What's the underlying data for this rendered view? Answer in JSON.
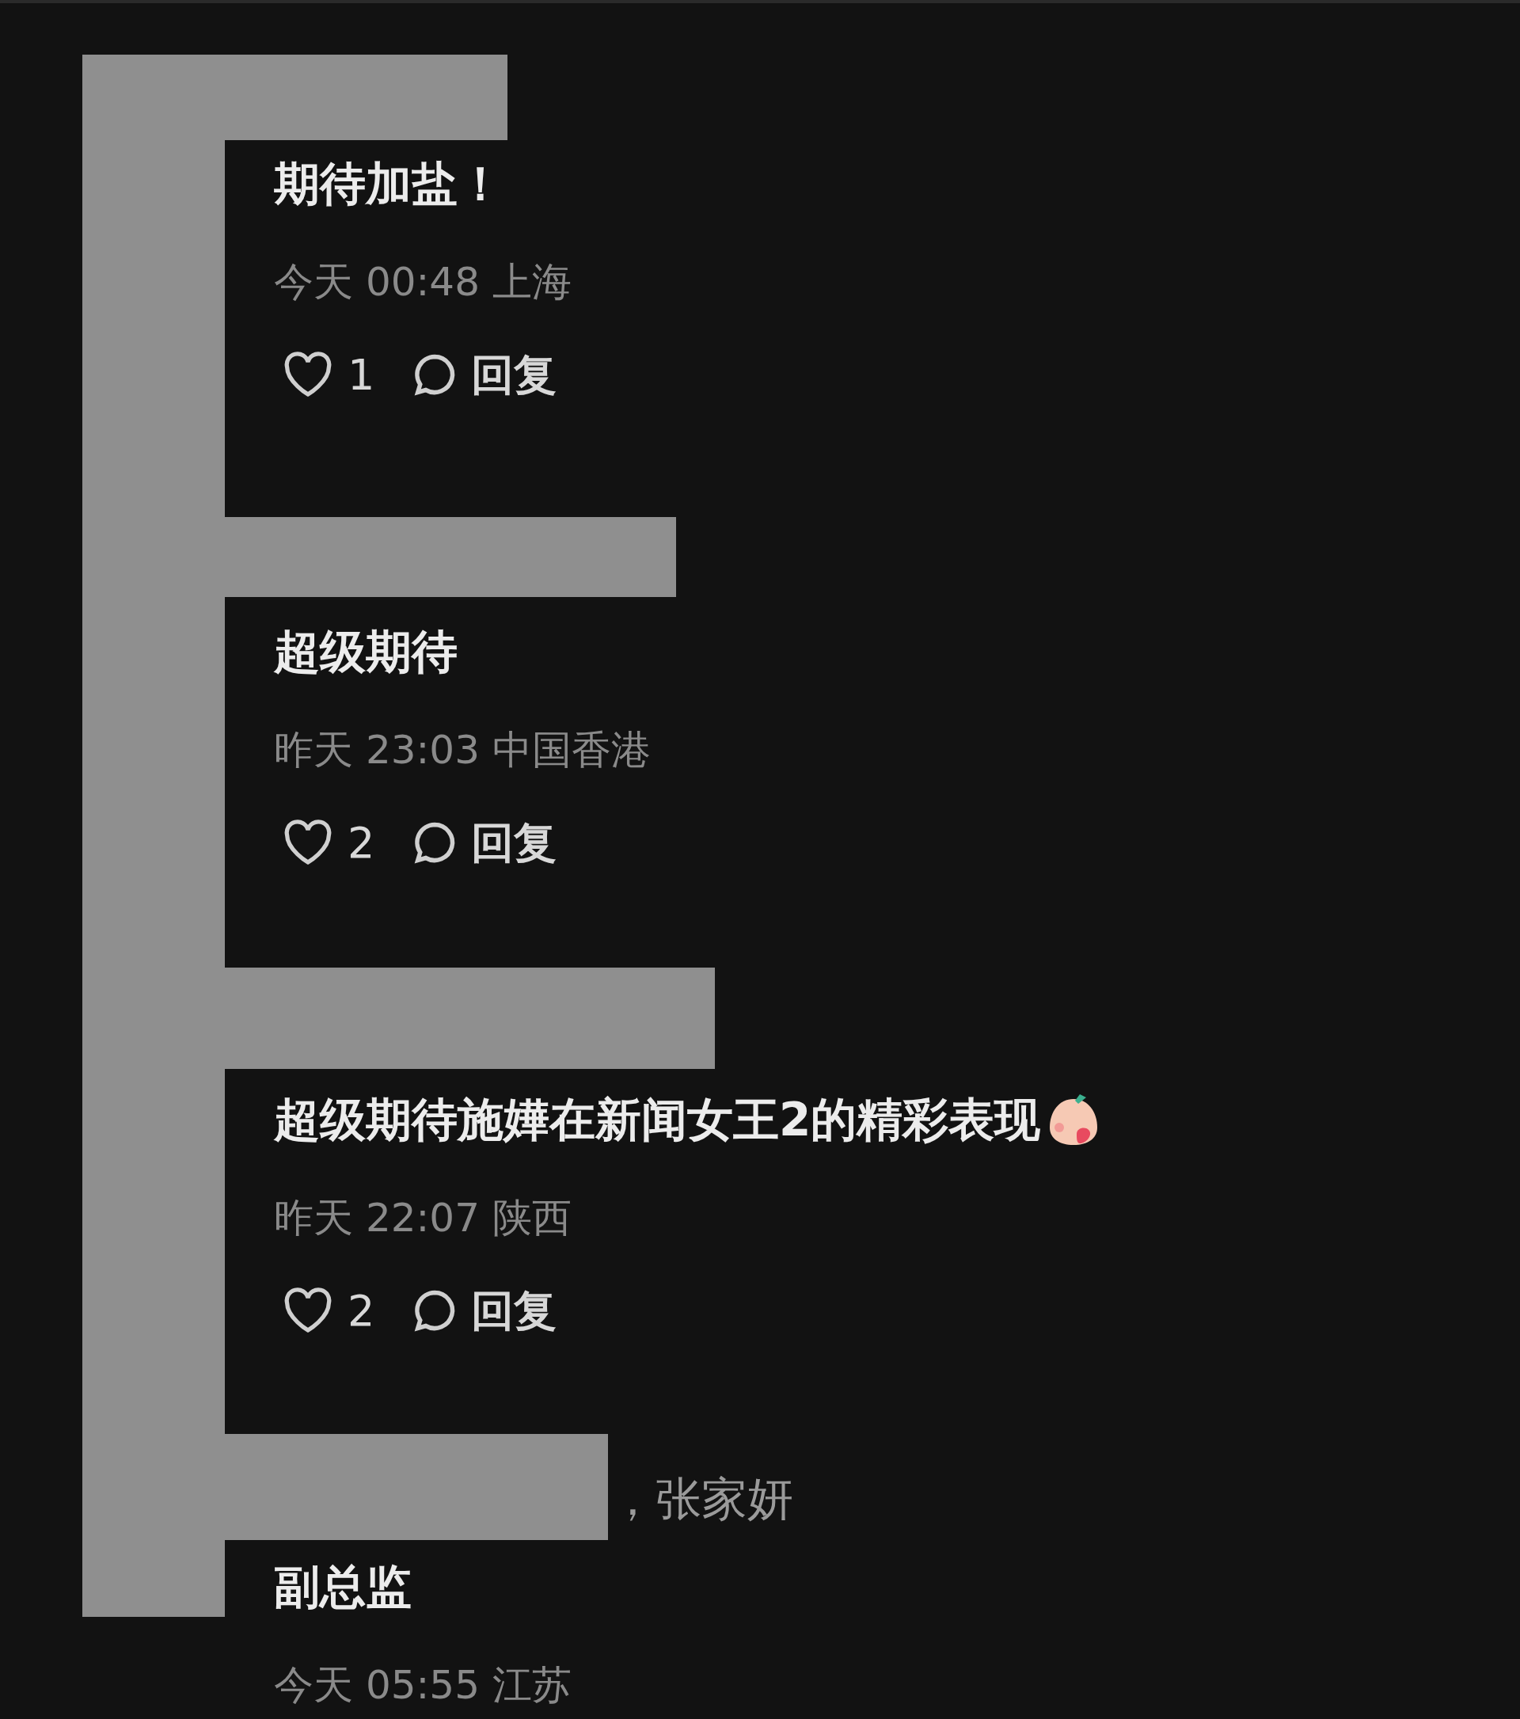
{
  "comments": [
    {
      "text": "期待加盐！",
      "meta": "今天 00:48 上海",
      "likes": "1",
      "reply": "回复"
    },
    {
      "text": "超级期待",
      "meta": "昨天 23:03 中国香港",
      "likes": "2",
      "reply": "回复"
    },
    {
      "text": "超级期待施嬅在新闻女王2的精彩表现",
      "emoji": true,
      "meta": "昨天 22:07 陕西",
      "likes": "2",
      "reply": "回复"
    },
    {
      "author": "，张家妍",
      "text": "副总监",
      "meta": "今天 05:55 江苏"
    }
  ]
}
